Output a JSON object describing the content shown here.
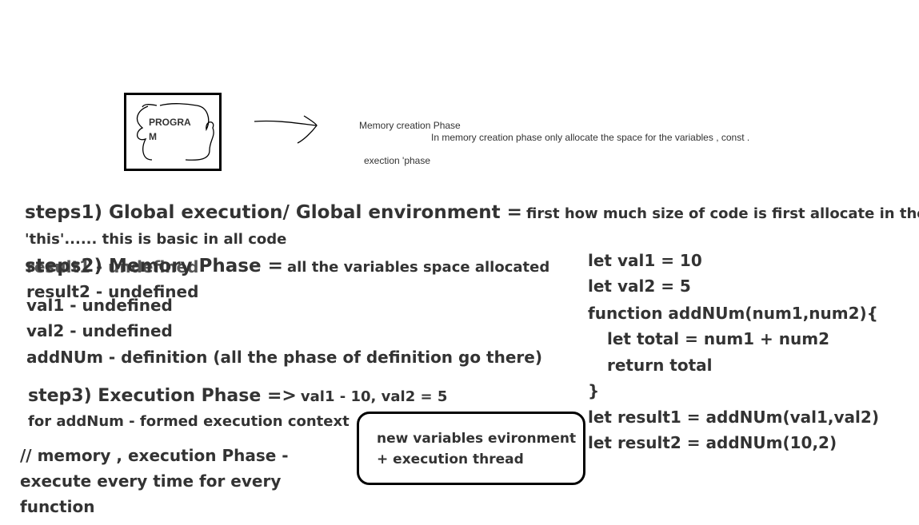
{
  "diagram": {
    "program_label": "PROGRAM",
    "memory_creation_phase": "Memory creation Phase",
    "memory_creation_note": "In memory creation phase only allocate the space for the variables , const .",
    "execution_phase": "exection 'phase"
  },
  "notes": {
    "step1_heading": "steps1) Global execution/ Global environment =",
    "step1_text": "first  how much size of code is first allocate in the",
    "step1_line2": "'this'...... this is basic in all code",
    "step2_heading": "steps2) Memory Phase =",
    "step2_text": "all the variables space allocated",
    "step2_overlap": "result1 - undefined",
    "step2_items": [
      "result2 - undefined",
      "val1 - undefined",
      "val2 - undefined",
      "addNUm - definition (all the phase of definition go there)"
    ],
    "step3_heading": "step3) Execution Phase =>",
    "step3_text": "val1 - 10, val2 = 5",
    "step3_line2": "for addNum - formed execution context",
    "comment_lines": [
      "// memory , execution Phase  -",
      "execute every time for every",
      "function"
    ],
    "callout_lines": [
      "new variables evironment",
      "+ execution thread"
    ]
  },
  "code": {
    "lines": [
      "let val1 = 10",
      "let val2 = 5",
      "function addNUm(num1,num2){",
      "let total = num1 + num2",
      "return total",
      "}",
      "let result1 = addNUm(val1,val2)",
      "let result2 = addNUm(10,2)"
    ]
  }
}
